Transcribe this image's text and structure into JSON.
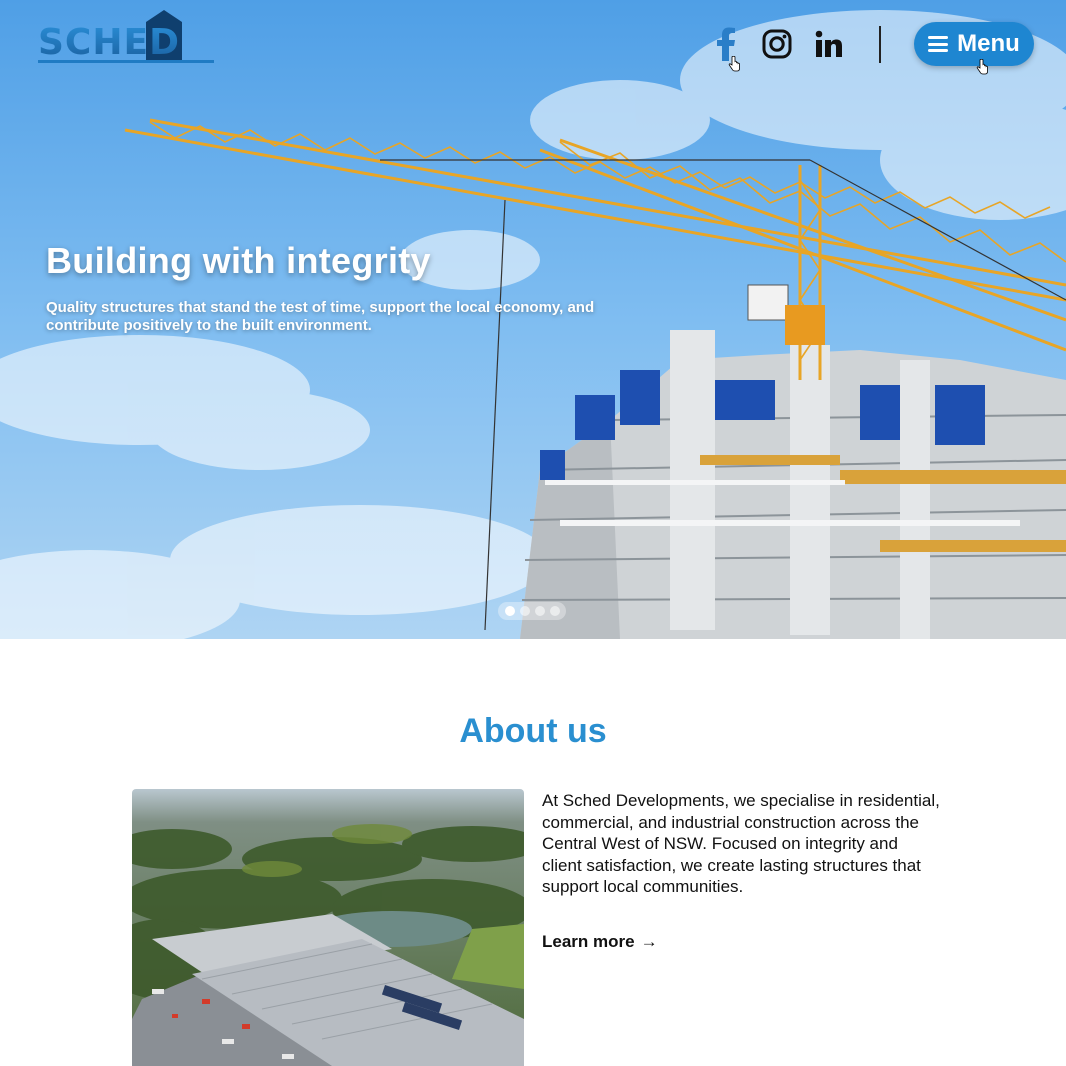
{
  "header": {
    "logo_text": "SCHED",
    "social": [
      {
        "name": "facebook",
        "icon": "facebook-icon"
      },
      {
        "name": "instagram",
        "icon": "instagram-icon"
      },
      {
        "name": "linkedin",
        "icon": "linkedin-icon"
      }
    ],
    "menu_label": "Menu"
  },
  "hero": {
    "title": "Building with integrity",
    "subtitle": "Quality structures that stand the test of time, support the local economy, and contribute positively to the built environment.",
    "slides_count": 4,
    "active_slide": 1
  },
  "about": {
    "title": "About us",
    "body": "At Sched Developments, we specialise in residential, commercial, and  industrial construction across the Central West of NSW. Focused on  integrity and client satisfaction, we create lasting structures that  support local communities.",
    "link_label": "Learn more",
    "link_arrow": "→"
  },
  "colors": {
    "brand_blue": "#1e86d1",
    "heading_blue": "#2a8fd0",
    "text_dark": "#111111"
  }
}
